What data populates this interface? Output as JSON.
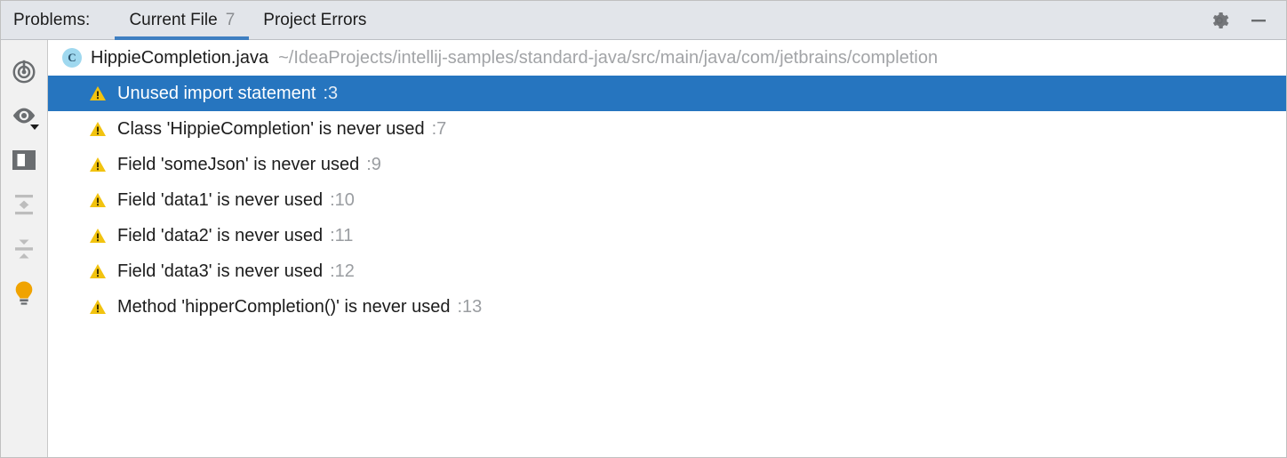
{
  "window": {
    "title_label": "Problems:"
  },
  "header": {
    "tabs": [
      {
        "label": "Current File",
        "count": "7",
        "active": true
      },
      {
        "label": "Project Errors",
        "count": "",
        "active": false
      }
    ],
    "actions": [
      {
        "name": "settings-gear",
        "icon": "gear-icon",
        "tooltip": "Settings"
      },
      {
        "name": "hide-panel",
        "icon": "minimize-icon",
        "tooltip": "Hide"
      }
    ]
  },
  "toolbar": {
    "items": [
      {
        "icon": "inspection-target-icon",
        "label": "Inspections",
        "enabled": true,
        "has_dropdown": false
      },
      {
        "icon": "eye-icon",
        "label": "View Options",
        "enabled": true,
        "has_dropdown": true
      },
      {
        "icon": "split-panel-icon",
        "label": "Open Editor Preview",
        "enabled": true,
        "has_dropdown": false
      },
      {
        "icon": "expand-all-icon",
        "label": "Expand All",
        "enabled": false,
        "has_dropdown": false
      },
      {
        "icon": "collapse-all-icon",
        "label": "Collapse All",
        "enabled": false,
        "has_dropdown": false
      },
      {
        "icon": "lightbulb-icon",
        "label": "Show Quick Fixes",
        "enabled": true,
        "has_dropdown": false
      }
    ]
  },
  "file": {
    "class_icon_letter": "C",
    "name": "HippieCompletion.java",
    "path": "~/IdeaProjects/intellij-samples/standard-java/src/main/java/com/jetbrains/completion"
  },
  "problems": [
    {
      "severity": "warning",
      "message": "Unused import statement",
      "line": ":3",
      "selected": true
    },
    {
      "severity": "warning",
      "message": "Class 'HippieCompletion' is never used",
      "line": ":7",
      "selected": false
    },
    {
      "severity": "warning",
      "message": "Field 'someJson' is never used",
      "line": ":9",
      "selected": false
    },
    {
      "severity": "warning",
      "message": "Field 'data1' is never used",
      "line": ":10",
      "selected": false
    },
    {
      "severity": "warning",
      "message": "Field 'data2' is never used",
      "line": ":11",
      "selected": false
    },
    {
      "severity": "warning",
      "message": "Field 'data3' is never used",
      "line": ":12",
      "selected": false
    },
    {
      "severity": "warning",
      "message": "Method 'hipperCompletion()' is never used",
      "line": ":13",
      "selected": false
    }
  ],
  "colors": {
    "header_bg": "#e2e5ea",
    "toolbar_bg": "#f1f1f1",
    "content_bg": "#ffffff",
    "selection_blue": "#2675bf",
    "tab_underline": "#3e7fc1",
    "warning_yellow": "#f2c30f",
    "lightbulb_orange": "#f0a300",
    "class_icon_blue": "#9fd8ef",
    "muted_text": "#a2a4a7"
  }
}
